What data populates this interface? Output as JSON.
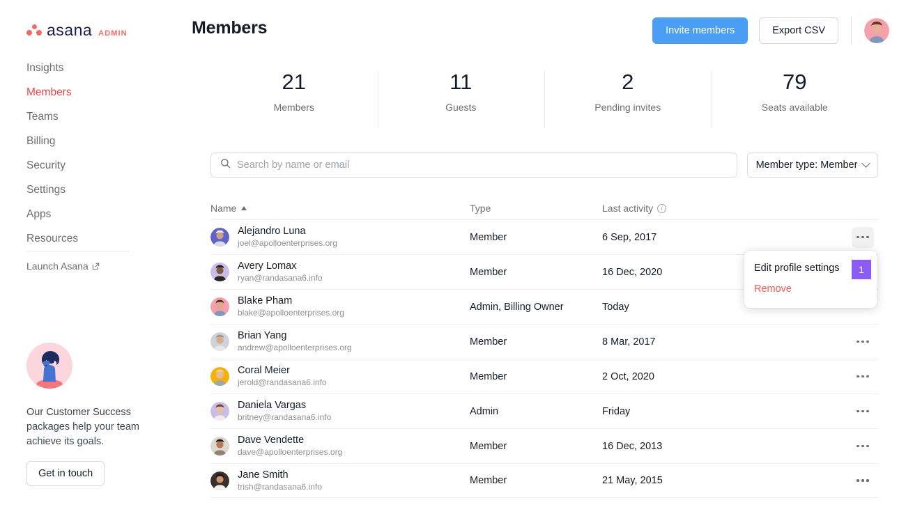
{
  "brand": {
    "logo_word": "asana",
    "logo_suffix": "ADMIN",
    "logo_dot_color": "#f06a6a",
    "accent_red": "#ef4444",
    "primary_blue": "#4a9ff5",
    "badge_purple": "#8b5cf6"
  },
  "sidebar": {
    "items": [
      {
        "label": "Insights",
        "active": false
      },
      {
        "label": "Members",
        "active": true
      },
      {
        "label": "Teams",
        "active": false
      },
      {
        "label": "Billing",
        "active": false
      },
      {
        "label": "Security",
        "active": false
      },
      {
        "label": "Settings",
        "active": false
      },
      {
        "label": "Apps",
        "active": false
      },
      {
        "label": "Resources",
        "active": false
      }
    ],
    "launch_label": "Launch Asana",
    "promo": {
      "text": "Our Customer Success packages help your team achieve its goals.",
      "button_label": "Get in touch"
    }
  },
  "header": {
    "title": "Members",
    "invite_label": "Invite members",
    "export_label": "Export CSV"
  },
  "stats": [
    {
      "value": "21",
      "label": "Members"
    },
    {
      "value": "11",
      "label": "Guests"
    },
    {
      "value": "2",
      "label": "Pending invites"
    },
    {
      "value": "79",
      "label": "Seats available"
    }
  ],
  "toolbar": {
    "search_placeholder": "Search by name or email",
    "search_value": "",
    "filter_label": "Member type: Member"
  },
  "table": {
    "columns": {
      "name": "Name",
      "type": "Type",
      "last_activity": "Last activity"
    },
    "sort": "asc",
    "rows": [
      {
        "name": "Alejandro Luna",
        "email": "joel@apolloenterprises.org",
        "type": "Member",
        "last_activity": "6 Sep, 2017",
        "avatar_bg": "#5e63c9",
        "skin": "#c9a08a",
        "hair": "#efe9e4",
        "shirt": "#d9dce5"
      },
      {
        "name": "Avery Lomax",
        "email": "ryan@randasana6.info",
        "type": "Member",
        "last_activity": "16 Dec, 2020",
        "avatar_bg": "#c9bce8",
        "skin": "#7d5a44",
        "hair": "#231b18",
        "shirt": "#2b2520"
      },
      {
        "name": "Blake Pham",
        "email": "blake@apolloenterprises.org",
        "type": "Admin, Billing Owner",
        "last_activity": "Today",
        "avatar_bg": "#f5a0aa",
        "skin": "#dba98c",
        "hair": "#4a3226",
        "shirt": "#7f98bb"
      },
      {
        "name": "Brian Yang",
        "email": "andrew@apolloenterprises.org",
        "type": "Member",
        "last_activity": "8 Mar, 2017",
        "avatar_bg": "#cfd2d6",
        "skin": "#d6ab8c",
        "hair": "#9a9a9a",
        "shirt": "#e8e8e8"
      },
      {
        "name": "Coral Meier",
        "email": "jerold@randasana6.info",
        "type": "Member",
        "last_activity": "2 Oct, 2020",
        "avatar_bg": "#f3b10c",
        "skin": "#e8bb9b",
        "hair": "#e8d39a",
        "shirt": "#9aa7b0"
      },
      {
        "name": "Daniela Vargas",
        "email": "britney@randasana6.info",
        "type": "Admin",
        "last_activity": "Friday",
        "avatar_bg": "#cbbde6",
        "skin": "#e8bfa4",
        "hair": "#6b4230",
        "shirt": "#f0ece8"
      },
      {
        "name": "Dave Vendette",
        "email": "dave@apolloenterprises.org",
        "type": "Member",
        "last_activity": "16 Dec, 2013",
        "avatar_bg": "#ddd7cd",
        "skin": "#b07c55",
        "hair": "#221a14",
        "shirt": "#8e8376"
      },
      {
        "name": "Jane Smith",
        "email": "trish@randasana6.info",
        "type": "Member",
        "last_activity": "21 May, 2015",
        "avatar_bg": "#3a2f2a",
        "skin": "#c99470",
        "hair": "#1d1411",
        "shirt": "#f2f0ee"
      }
    ]
  },
  "context_menu": {
    "open_for_row": 0,
    "items": [
      {
        "label": "Edit profile settings",
        "danger": false,
        "badge": "1"
      },
      {
        "label": "Remove",
        "danger": true,
        "badge": null
      }
    ]
  }
}
